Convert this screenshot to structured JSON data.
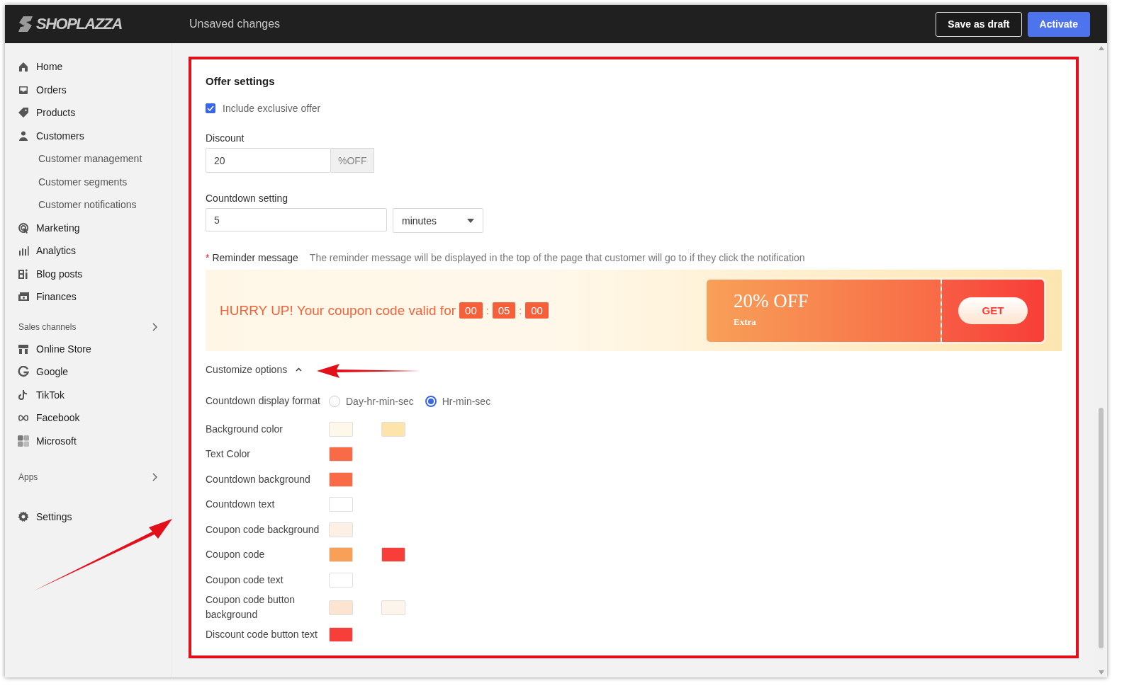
{
  "header": {
    "logo": "SHOPLAZZA",
    "status": "Unsaved changes",
    "buttons": [
      {
        "label": "Save as draft",
        "kind": "outline"
      },
      {
        "label": "Activate",
        "kind": "primary"
      }
    ]
  },
  "sidebar": {
    "main": [
      {
        "label": "Home"
      },
      {
        "label": "Orders"
      },
      {
        "label": "Products"
      },
      {
        "label": "Customers",
        "children": [
          {
            "label": "Customer management"
          },
          {
            "label": "Customer segments"
          },
          {
            "label": "Customer notifications"
          }
        ]
      },
      {
        "label": "Marketing"
      },
      {
        "label": "Analytics"
      },
      {
        "label": "Blog posts"
      },
      {
        "label": "Finances"
      }
    ],
    "sales_channels": {
      "heading": "Sales channels",
      "items": [
        {
          "label": "Online Store"
        },
        {
          "label": "Google"
        },
        {
          "label": "TikTok"
        },
        {
          "label": "Facebook"
        },
        {
          "label": "Microsoft"
        }
      ]
    },
    "apps": {
      "heading": "Apps"
    },
    "settings": {
      "label": "Settings"
    }
  },
  "offer": {
    "title": "Offer settings",
    "include_offer": {
      "label": "Include exclusive offer",
      "checked": true
    },
    "discount": {
      "label": "Discount",
      "value": "20",
      "suffix": "%OFF"
    },
    "countdown": {
      "label": "Countdown setting",
      "value": "5",
      "unit": "minutes"
    },
    "reminder": {
      "label": "Reminder message",
      "required_mark": "*",
      "hint": "The reminder message will be displayed in the top of the page that customer will go to if they click the notification"
    },
    "banner": {
      "text": "HURRY UP! Your coupon code valid for",
      "timer": [
        "00",
        "05",
        "00"
      ],
      "timer_separator": ":",
      "coupon_title": "20% OFF",
      "coupon_subtitle": "Extra",
      "button": "GET"
    },
    "customize": {
      "label": "Customize options",
      "expanded": true
    },
    "options": [
      {
        "label": "Countdown display format",
        "kind": "radio",
        "choices": [
          {
            "label": "Day-hr-min-sec",
            "selected": false
          },
          {
            "label": "Hr-min-sec",
            "selected": true
          }
        ]
      },
      {
        "label": "Background color",
        "kind": "colors",
        "swatches": [
          {
            "color": "#fef8ea"
          },
          {
            "color": "#fde4ab"
          }
        ]
      },
      {
        "label": "Text Color",
        "kind": "colors",
        "swatches": [
          {
            "color": "#f96a46"
          }
        ]
      },
      {
        "label": "Countdown background",
        "kind": "colors",
        "swatches": [
          {
            "color": "#f96a46"
          }
        ]
      },
      {
        "label": "Countdown text",
        "kind": "colors",
        "swatches": [
          {
            "color": "#ffffff"
          }
        ]
      },
      {
        "label": "Coupon code background",
        "kind": "colors",
        "swatches": [
          {
            "color": "#fdefe3"
          }
        ]
      },
      {
        "label": "Coupon code",
        "kind": "colors",
        "swatches": [
          {
            "color": "#f8a058"
          },
          {
            "color": "#f83e38"
          }
        ]
      },
      {
        "label": "Coupon code text",
        "kind": "colors",
        "swatches": [
          {
            "color": "#ffffff"
          }
        ]
      },
      {
        "label": "Coupon code button background",
        "kind": "colors",
        "swatches": [
          {
            "color": "#fde4d0"
          },
          {
            "color": "#fdf5ec"
          }
        ]
      },
      {
        "label": "Discount code button text",
        "kind": "colors",
        "swatches": [
          {
            "color": "#f83e38"
          }
        ]
      }
    ]
  }
}
